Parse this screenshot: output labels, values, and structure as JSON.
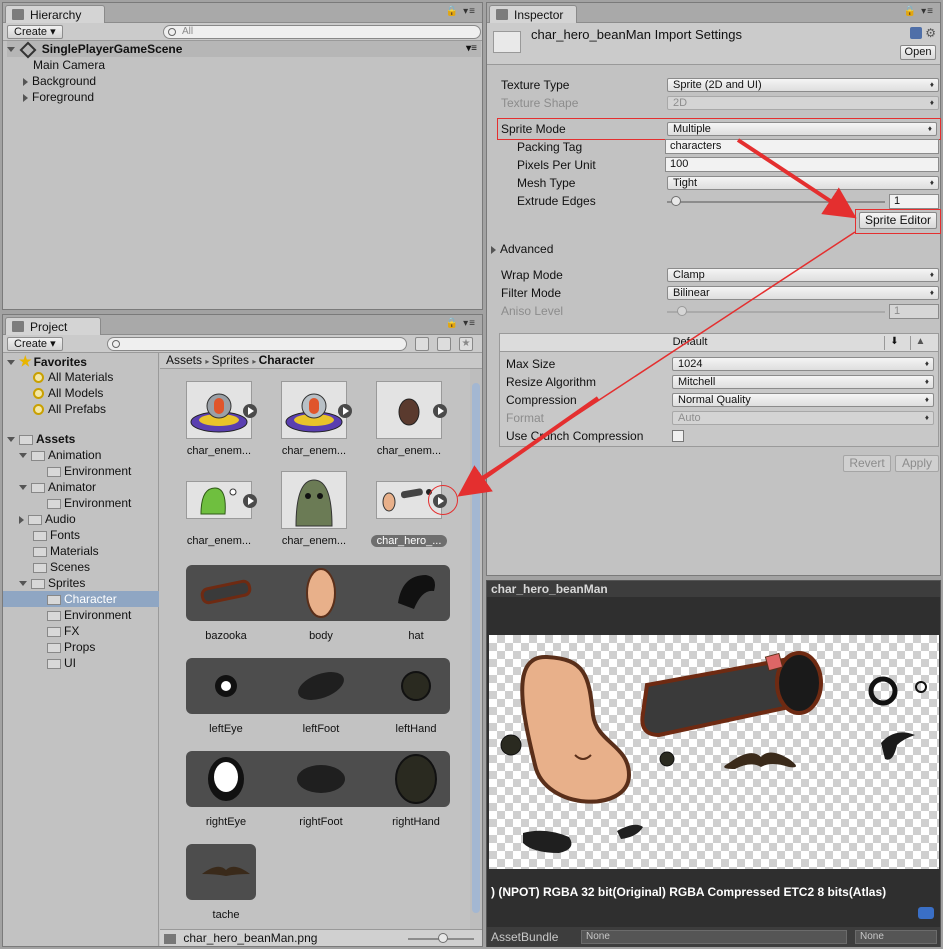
{
  "hierarchy": {
    "tab_label": "Hierarchy",
    "create_label": "Create ▾",
    "search_placeholder": "All",
    "scene_name": "SinglePlayerGameScene",
    "items": [
      "Main Camera",
      "Background",
      "Foreground"
    ]
  },
  "project": {
    "tab_label": "Project",
    "create_label": "Create ▾",
    "favorites_label": "Favorites",
    "favorites": [
      "All Materials",
      "All Models",
      "All Prefabs"
    ],
    "assets_label": "Assets",
    "tree": [
      {
        "label": "Animation",
        "level": 1,
        "arrow": "down"
      },
      {
        "label": "Environment",
        "level": 2,
        "arrow": "none"
      },
      {
        "label": "Animator",
        "level": 1,
        "arrow": "down"
      },
      {
        "label": "Environment",
        "level": 2,
        "arrow": "none"
      },
      {
        "label": "Audio",
        "level": 1,
        "arrow": "right"
      },
      {
        "label": "Fonts",
        "level": 1,
        "arrow": "none"
      },
      {
        "label": "Materials",
        "level": 1,
        "arrow": "none"
      },
      {
        "label": "Scenes",
        "level": 1,
        "arrow": "none"
      },
      {
        "label": "Sprites",
        "level": 1,
        "arrow": "down"
      },
      {
        "label": "Character",
        "level": 2,
        "arrow": "none",
        "selected": true
      },
      {
        "label": "Environment",
        "level": 2,
        "arrow": "none"
      },
      {
        "label": "FX",
        "level": 2,
        "arrow": "none"
      },
      {
        "label": "Props",
        "level": 2,
        "arrow": "none"
      },
      {
        "label": "UI",
        "level": 2,
        "arrow": "none"
      }
    ],
    "breadcrumb": [
      "Assets",
      "Sprites",
      "Character"
    ],
    "assets": [
      "char_enem...",
      "char_enem...",
      "char_enem...",
      "char_enem...",
      "char_enem...",
      "char_hero_..."
    ],
    "sprite_rows": [
      [
        "bazooka",
        "body",
        "hat"
      ],
      [
        "leftEye",
        "leftFoot",
        "leftHand"
      ],
      [
        "rightEye",
        "rightFoot",
        "rightHand"
      ],
      [
        "tache"
      ]
    ],
    "footer_file": "char_hero_beanMan.png"
  },
  "inspector": {
    "tab_label": "Inspector",
    "title": "char_hero_beanMan Import Settings",
    "open_label": "Open",
    "texture_type_label": "Texture Type",
    "texture_type_value": "Sprite (2D and UI)",
    "texture_shape_label": "Texture Shape",
    "texture_shape_value": "2D",
    "sprite_mode_label": "Sprite Mode",
    "sprite_mode_value": "Multiple",
    "packing_tag_label": "Packing Tag",
    "packing_tag_value": "characters",
    "ppu_label": "Pixels Per Unit",
    "ppu_value": "100",
    "mesh_type_label": "Mesh Type",
    "mesh_type_value": "Tight",
    "extrude_label": "Extrude Edges",
    "extrude_value": "1",
    "sprite_editor_label": "Sprite Editor",
    "advanced_label": "Advanced",
    "wrap_label": "Wrap Mode",
    "wrap_value": "Clamp",
    "filter_label": "Filter Mode",
    "filter_value": "Bilinear",
    "aniso_label": "Aniso Level",
    "aniso_value": "1",
    "platform_default": "Default",
    "max_size_label": "Max Size",
    "max_size_value": "1024",
    "resize_label": "Resize Algorithm",
    "resize_value": "Mitchell",
    "compression_label": "Compression",
    "compression_value": "Normal Quality",
    "format_label": "Format",
    "format_value": "Auto",
    "crunch_label": "Use Crunch Compression",
    "revert_label": "Revert",
    "apply_label": "Apply"
  },
  "preview": {
    "title": "char_hero_beanMan",
    "info": ") (NPOT)   RGBA 32 bit(Original) RGBA Compressed ETC2 8 bits(Atlas)",
    "assetbundle_label": "AssetBundle",
    "bundle_value": "None",
    "variant_value": "None"
  },
  "colors": {
    "panel_bg": "#c2c2c2",
    "selection": "#8fa6c3",
    "annotation_red": "#e42f2f",
    "sprite_dark": "#4d4d4d",
    "bean_skin": "#e8b08a"
  }
}
